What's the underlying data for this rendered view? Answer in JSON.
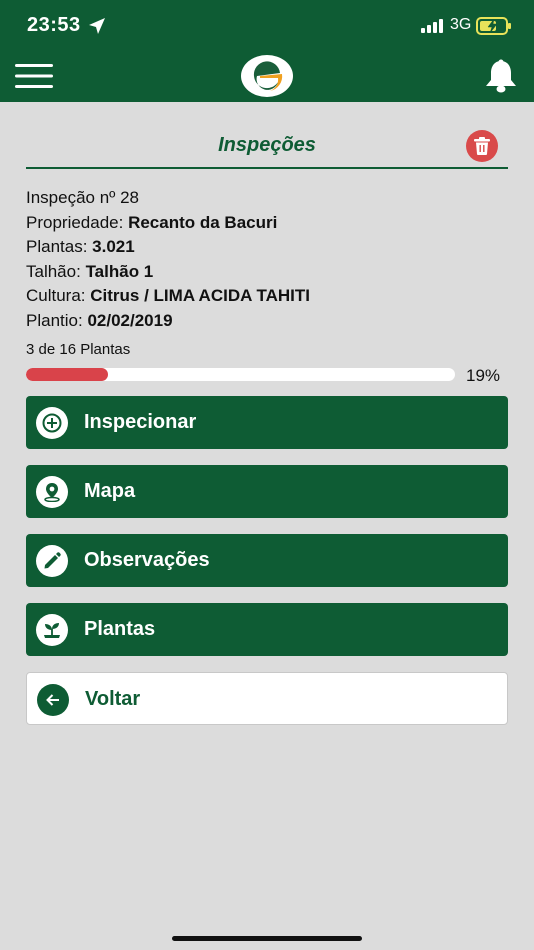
{
  "status_bar": {
    "time": "23:53",
    "network": "3G"
  },
  "header": {
    "menu_icon": "hamburger-menu-icon",
    "logo_icon": "app-logo",
    "bell_icon": "bell-icon"
  },
  "page": {
    "title": "Inspeções",
    "delete_icon": "trash-icon"
  },
  "inspection": {
    "number_label": "Inspeção nº 28",
    "property_label": "Propriedade:",
    "property_value": "Recanto da Bacuri",
    "plants_label": "Plantas:",
    "plants_value": "3.021",
    "plot_label": "Talhão:",
    "plot_value": "Talhão 1",
    "crop_label": "Cultura:",
    "crop_value": "Citrus / LIMA ACIDA TAHITI",
    "planting_label": "Plantio:",
    "planting_value": "02/02/2019"
  },
  "progress": {
    "count_text": "3 de 16 Plantas",
    "fraction": 0.19,
    "percent_text": "19%"
  },
  "actions": {
    "inspect": "Inspecionar",
    "map": "Mapa",
    "notes": "Observações",
    "plants": "Plantas",
    "back": "Voltar"
  },
  "colors": {
    "brand_green": "#0e5c34",
    "danger_red": "#d94a4a",
    "logo_orange": "#f0a020",
    "background": "#dcdcdc"
  }
}
